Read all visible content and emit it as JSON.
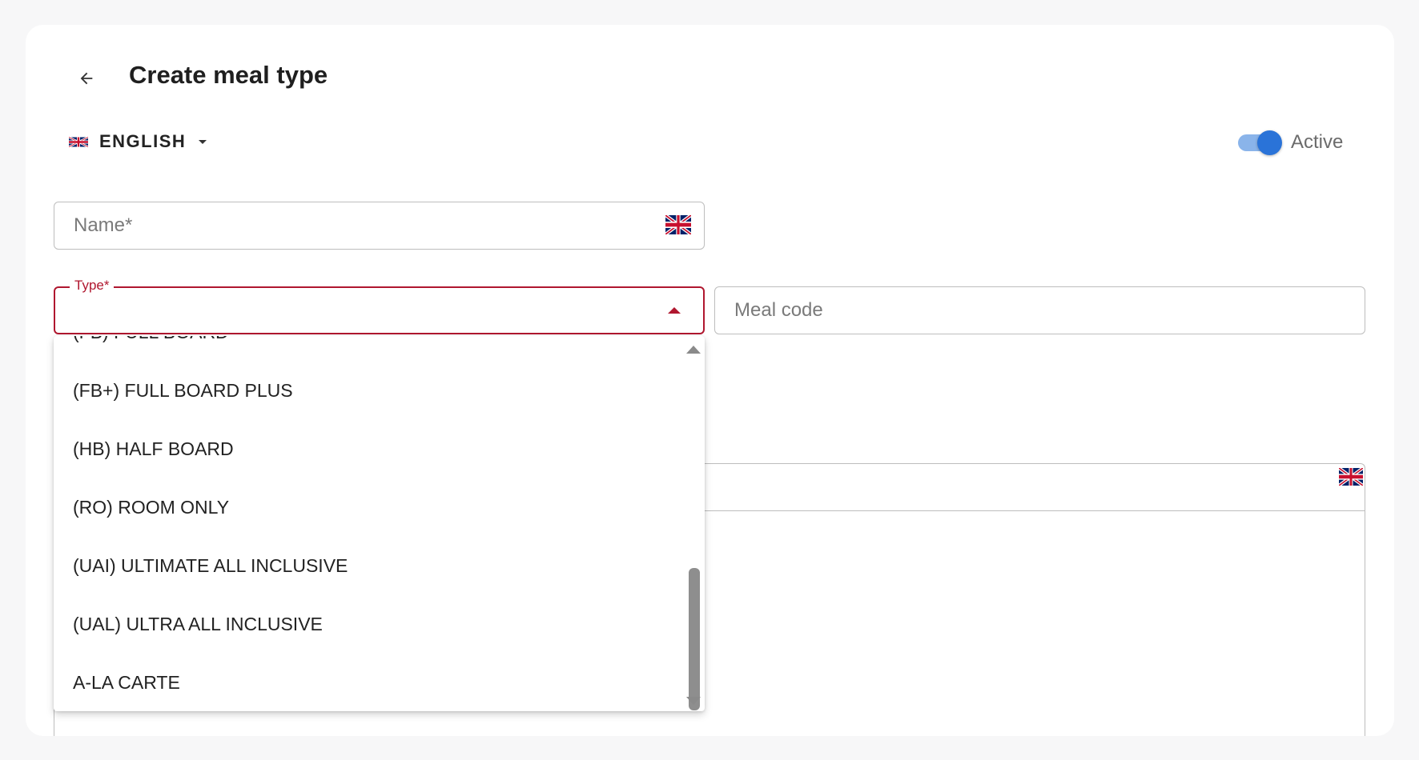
{
  "header": {
    "title": "Create meal type",
    "back_icon": "arrow-left-icon"
  },
  "language": {
    "label": "ENGLISH",
    "flag_icon": "uk-flag-icon",
    "dropdown_icon": "caret-down-icon"
  },
  "status": {
    "label": "Active",
    "on": true,
    "accent": "#2a73d8"
  },
  "form": {
    "name_placeholder": "Name*",
    "type_label": "Type*",
    "meal_code_placeholder": "Meal code",
    "error_color": "#b0172f"
  },
  "type_dropdown": {
    "options": [
      "(FB) FULL BOARD",
      "(FB+) FULL BOARD PLUS",
      "(HB) HALF BOARD",
      "(RO) ROOM ONLY",
      "(UAI) ULTIMATE ALL INCLUSIVE",
      "(UAL) ULTRA ALL INCLUSIVE",
      "A-LA CARTE"
    ]
  }
}
